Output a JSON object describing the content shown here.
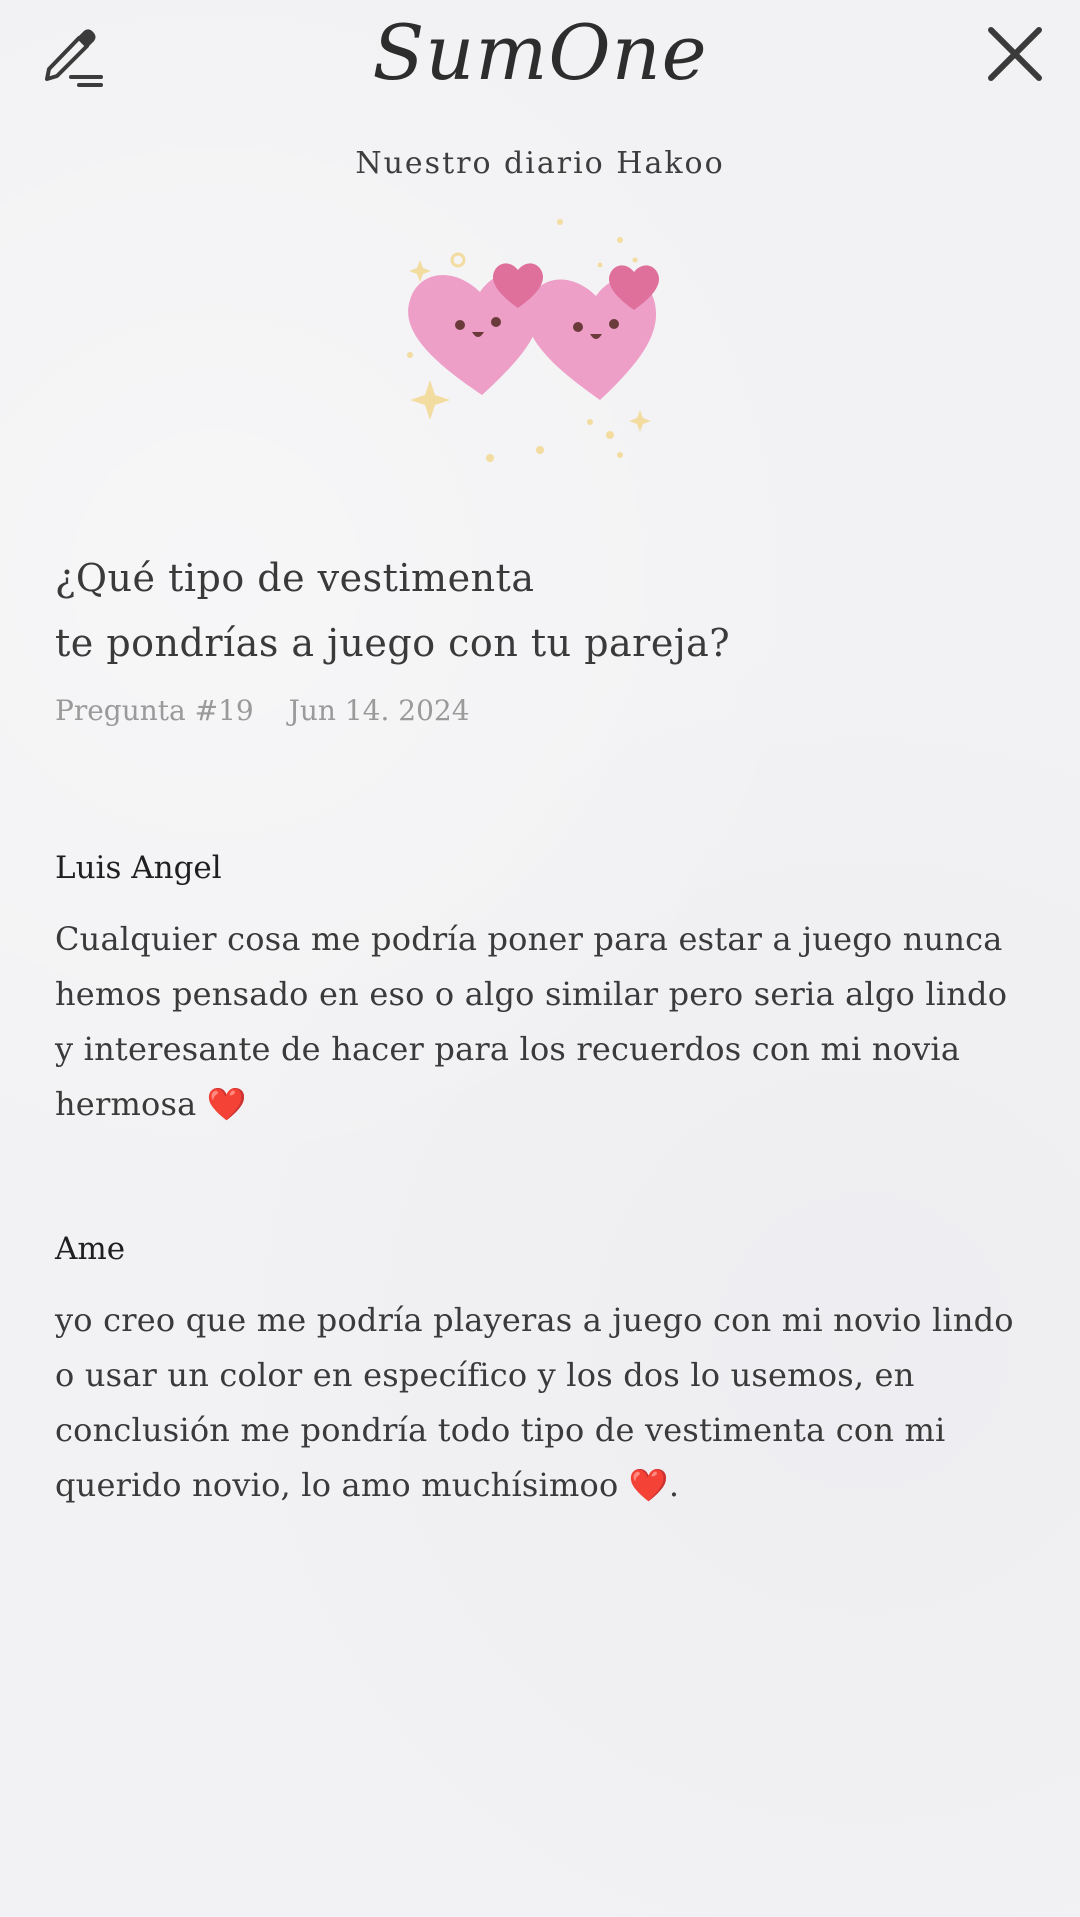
{
  "header": {
    "brand": "SumOne",
    "edit_icon": "pencil-edit-icon",
    "close_icon": "close-icon"
  },
  "diary": {
    "title": "Nuestro diario Hakoo",
    "illustration": "two-happy-pink-hearts-illustration"
  },
  "question": {
    "line1": "¿Qué tipo de vestimenta",
    "line2": "te pondrías a juego con tu pareja?",
    "number": "Pregunta #19",
    "date": "Jun 14. 2024"
  },
  "answers": [
    {
      "author": "Luis Angel",
      "text": "Cualquier cosa me podría poner para estar a juego nunca hemos pensado en eso o algo similar pero seria algo lindo y interesante de hacer para los recuerdos con mi novia hermosa ❤️"
    },
    {
      "author": "Ame",
      "text": "yo creo que me podría playeras a juego con mi novio lindo o usar un color en específico y los dos lo usemos, en conclusión me pondría todo tipo de vestimenta con mi querido novio, lo amo muchísimoo ❤️."
    }
  ],
  "colors": {
    "background": "#f2f2f4",
    "heart_pink": "#ee9fc8",
    "heart_dark_pink": "#df6f9b",
    "sparkle_yellow": "#f3dca0",
    "meta_gray": "#9a9a9a"
  }
}
